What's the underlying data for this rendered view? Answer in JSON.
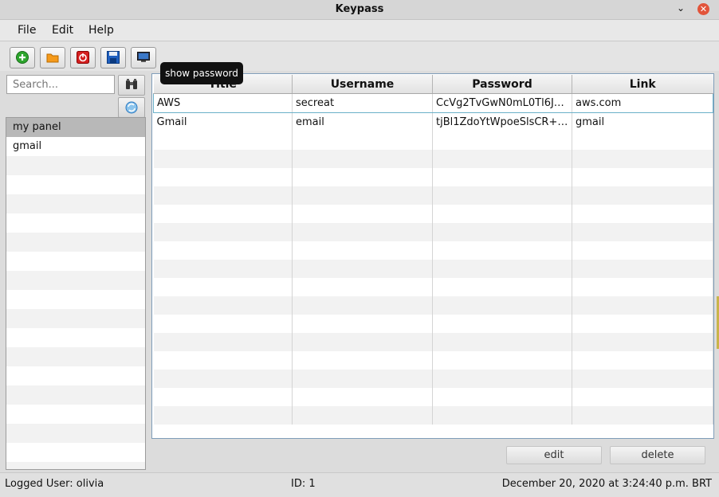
{
  "window": {
    "title": "Keypass"
  },
  "menu": {
    "file": "File",
    "edit": "Edit",
    "help": "Help"
  },
  "toolbar": {
    "buttons": [
      {
        "icon": "add-icon"
      },
      {
        "icon": "folder-icon"
      },
      {
        "icon": "power-icon"
      },
      {
        "icon": "save-icon"
      },
      {
        "icon": "monitor-icon"
      }
    ],
    "tooltip": "show password"
  },
  "search": {
    "placeholder": "Search..."
  },
  "panels": {
    "items": [
      "my panel",
      "gmail"
    ],
    "selected": "my panel"
  },
  "table": {
    "columns": [
      "Title",
      "Username",
      "Password",
      "Link"
    ],
    "rows": [
      {
        "title": "AWS",
        "username": "secreat",
        "password": "CcVg2TvGwN0mL0Tl6J…",
        "link": "aws.com"
      },
      {
        "title": "Gmail",
        "username": "email",
        "password": "tjBl1ZdoYtWpoeSlsCR+…",
        "link": "gmail"
      }
    ]
  },
  "actions": {
    "edit": "edit",
    "delete": "delete"
  },
  "status": {
    "user": "Logged User: olivia",
    "id": "ID: 1",
    "datetime": "December 20, 2020 at 3:24:40 p.m. BRT"
  },
  "colors": {
    "accent_selection": "#6ab0c8",
    "close": "#e2543a"
  }
}
